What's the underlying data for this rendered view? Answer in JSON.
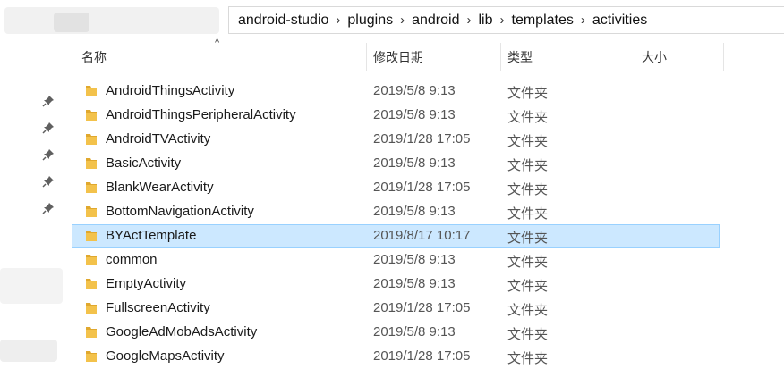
{
  "breadcrumb": [
    "android-studio",
    "plugins",
    "android",
    "lib",
    "templates",
    "activities"
  ],
  "breadcrumb_separator": "›",
  "columns": {
    "name": "名称",
    "date": "修改日期",
    "type": "类型",
    "size": "大小"
  },
  "sort_indicator": "^",
  "rows": [
    {
      "name": "AndroidThingsActivity",
      "date": "2019/5/8 9:13",
      "type": "文件夹",
      "selected": false
    },
    {
      "name": "AndroidThingsPeripheralActivity",
      "date": "2019/5/8 9:13",
      "type": "文件夹",
      "selected": false
    },
    {
      "name": "AndroidTVActivity",
      "date": "2019/1/28 17:05",
      "type": "文件夹",
      "selected": false
    },
    {
      "name": "BasicActivity",
      "date": "2019/5/8 9:13",
      "type": "文件夹",
      "selected": false
    },
    {
      "name": "BlankWearActivity",
      "date": "2019/1/28 17:05",
      "type": "文件夹",
      "selected": false
    },
    {
      "name": "BottomNavigationActivity",
      "date": "2019/5/8 9:13",
      "type": "文件夹",
      "selected": false
    },
    {
      "name": "BYActTemplate",
      "date": "2019/8/17 10:17",
      "type": "文件夹",
      "selected": true
    },
    {
      "name": "common",
      "date": "2019/5/8 9:13",
      "type": "文件夹",
      "selected": false
    },
    {
      "name": "EmptyActivity",
      "date": "2019/5/8 9:13",
      "type": "文件夹",
      "selected": false
    },
    {
      "name": "FullscreenActivity",
      "date": "2019/1/28 17:05",
      "type": "文件夹",
      "selected": false
    },
    {
      "name": "GoogleAdMobAdsActivity",
      "date": "2019/5/8 9:13",
      "type": "文件夹",
      "selected": false
    },
    {
      "name": "GoogleMapsActivity",
      "date": "2019/1/28 17:05",
      "type": "文件夹",
      "selected": false
    }
  ],
  "colors": {
    "selection": "#cce8ff",
    "selection_border": "#99d1ff",
    "folder": "#f3c24b"
  },
  "icons": {
    "folder": "folder-icon",
    "pin": "pin-icon"
  }
}
